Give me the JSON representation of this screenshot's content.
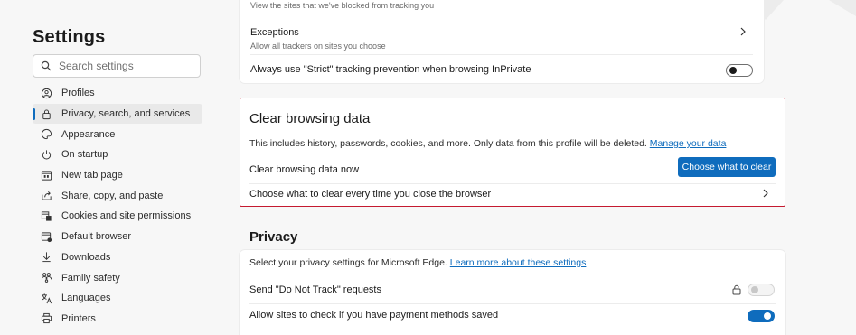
{
  "sidebar": {
    "title": "Settings",
    "search_placeholder": "Search settings",
    "items": [
      {
        "label": "Profiles",
        "icon": "profile-icon",
        "active": false
      },
      {
        "label": "Privacy, search, and services",
        "icon": "lock-icon",
        "active": true
      },
      {
        "label": "Appearance",
        "icon": "appearance-icon",
        "active": false
      },
      {
        "label": "On startup",
        "icon": "power-icon",
        "active": false
      },
      {
        "label": "New tab page",
        "icon": "new-tab-icon",
        "active": false
      },
      {
        "label": "Share, copy, and paste",
        "icon": "share-icon",
        "active": false
      },
      {
        "label": "Cookies and site permissions",
        "icon": "cookies-icon",
        "active": false
      },
      {
        "label": "Default browser",
        "icon": "browser-icon",
        "active": false
      },
      {
        "label": "Downloads",
        "icon": "download-icon",
        "active": false
      },
      {
        "label": "Family safety",
        "icon": "family-icon",
        "active": false
      },
      {
        "label": "Languages",
        "icon": "language-icon",
        "active": false
      },
      {
        "label": "Printers",
        "icon": "printer-icon",
        "active": false
      }
    ]
  },
  "tracking": {
    "blocked_sub": "View the sites that we've blocked from tracking you",
    "exceptions_label": "Exceptions",
    "exceptions_sub": "Allow all trackers on sites you choose",
    "strict_label": "Always use \"Strict\" tracking prevention when browsing InPrivate",
    "strict_on": false
  },
  "clear_browsing": {
    "title": "Clear browsing data",
    "description": "This includes history, passwords, cookies, and more. Only data from this profile will be deleted.",
    "manage_link": "Manage your data",
    "now_label": "Clear browsing data now",
    "button_label": "Choose what to clear",
    "on_close_label": "Choose what to clear every time you close the browser"
  },
  "privacy": {
    "title": "Privacy",
    "description": "Select your privacy settings for Microsoft Edge.",
    "learn_link": "Learn more about these settings",
    "dnt_label": "Send \"Do Not Track\" requests",
    "dnt_on": false,
    "dnt_disabled": true,
    "payment_label": "Allow sites to check if you have payment methods saved",
    "payment_on": true
  },
  "colors": {
    "accent": "#0f6cbd",
    "highlight_border": "#c51a30",
    "active_nav_bg": "#e9e9e9"
  }
}
